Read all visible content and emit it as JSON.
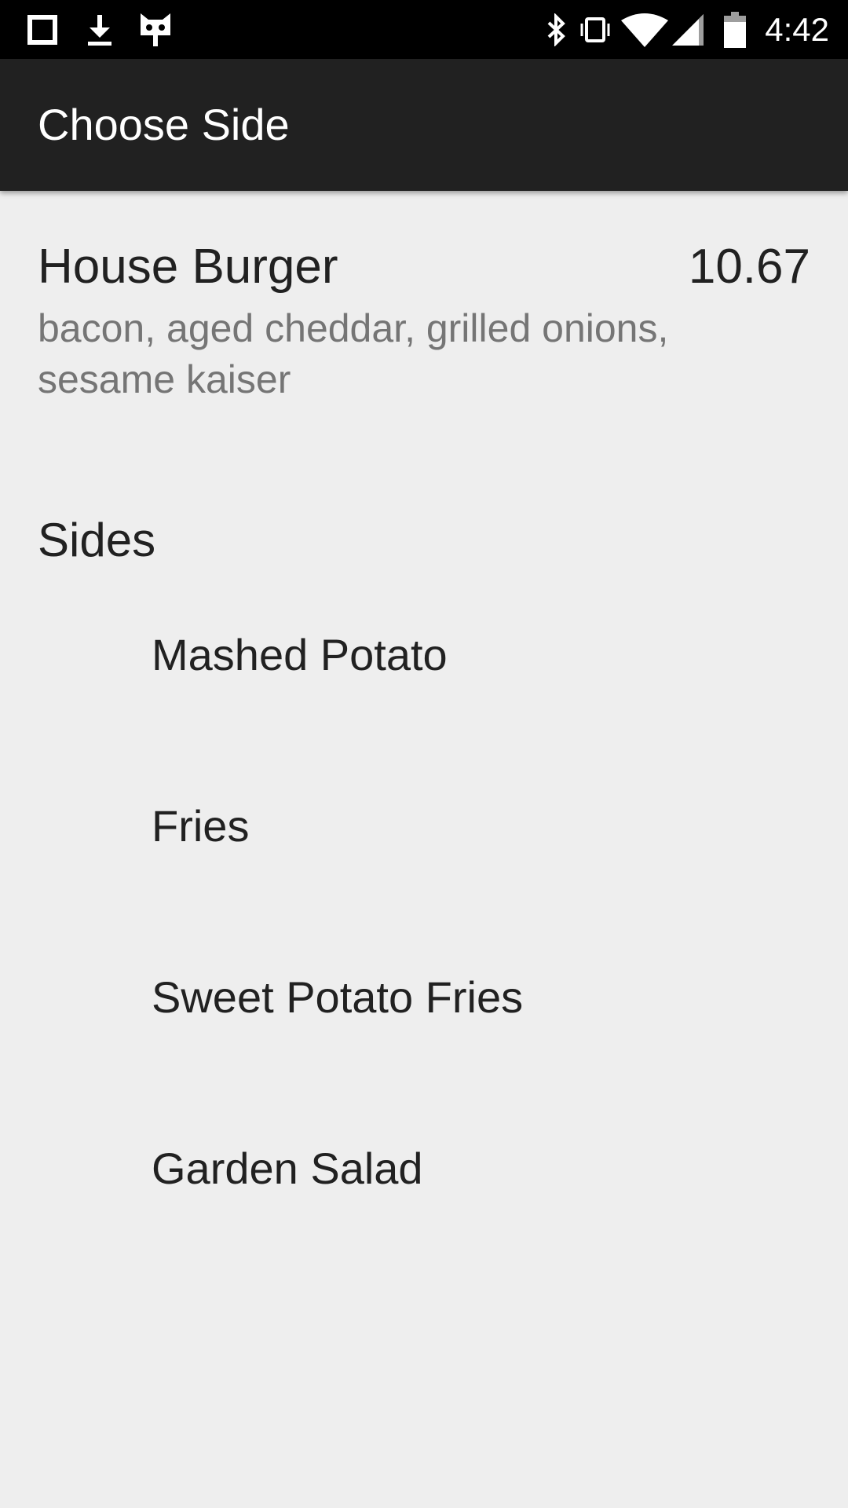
{
  "status_bar": {
    "time": "4:42",
    "left_icons": [
      "notification-square-icon",
      "download-icon",
      "cyanogen-mascot-icon"
    ],
    "right_icons": [
      "bluetooth-icon",
      "vibrate-icon",
      "wifi-icon",
      "cellular-signal-icon",
      "battery-icon"
    ]
  },
  "app_bar": {
    "title": "Choose Side",
    "background": "#212121"
  },
  "item": {
    "name": "House Burger",
    "price": "10.67",
    "description": "bacon, aged cheddar, grilled onions, sesame kaiser"
  },
  "sides": {
    "title": "Sides",
    "options": [
      {
        "label": "Mashed Potato"
      },
      {
        "label": "Fries"
      },
      {
        "label": "Sweet Potato Fries"
      },
      {
        "label": "Garden Salad"
      }
    ]
  },
  "colors": {
    "background": "#eeeeee",
    "status_bar": "#000000",
    "primary_text": "#212121",
    "secondary_text": "#757575"
  }
}
